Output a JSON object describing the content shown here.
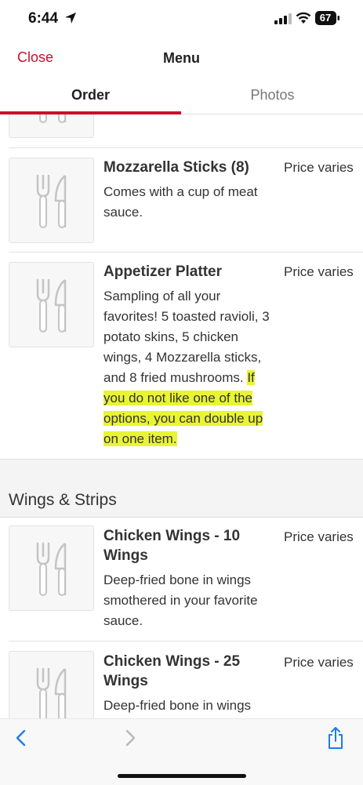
{
  "status": {
    "time": "6:44",
    "battery": "67"
  },
  "header": {
    "close_label": "Close",
    "title": "Menu"
  },
  "tabs": [
    {
      "label": "Order"
    },
    {
      "label": "Photos"
    }
  ],
  "items": [
    {
      "name": "Mozzarella Sticks (8)",
      "price": "Price varies",
      "description": "Comes with a cup of meat sauce."
    },
    {
      "name": "Appetizer Platter",
      "price": "Price varies",
      "description": "Sampling of all your favorites! 5 toasted ravioli, 3 potato skins, 5 chicken wings, 4 Mozzarella sticks, and 8 fried mushrooms.",
      "description_highlight": "If you do not like one of the options, you can double up on one item."
    }
  ],
  "section": {
    "title": "Wings & Strips"
  },
  "wings": [
    {
      "name": "Chicken Wings - 10 Wings",
      "price": "Price varies",
      "description": "Deep-fried bone in wings smothered in your favorite sauce."
    },
    {
      "name": "Chicken Wings - 25 Wings",
      "price": "Price varies",
      "description": "Deep-fried bone in wings"
    }
  ],
  "icons": [
    "location-arrow-icon",
    "signal-icon",
    "wifi-icon",
    "battery-icon",
    "fork-knife-icon",
    "back-chevron-icon",
    "forward-chevron-icon",
    "share-icon"
  ],
  "colors": {
    "accent": "#c8102e",
    "highlight": "#e9f532",
    "link_blue": "#1a7cf5"
  }
}
